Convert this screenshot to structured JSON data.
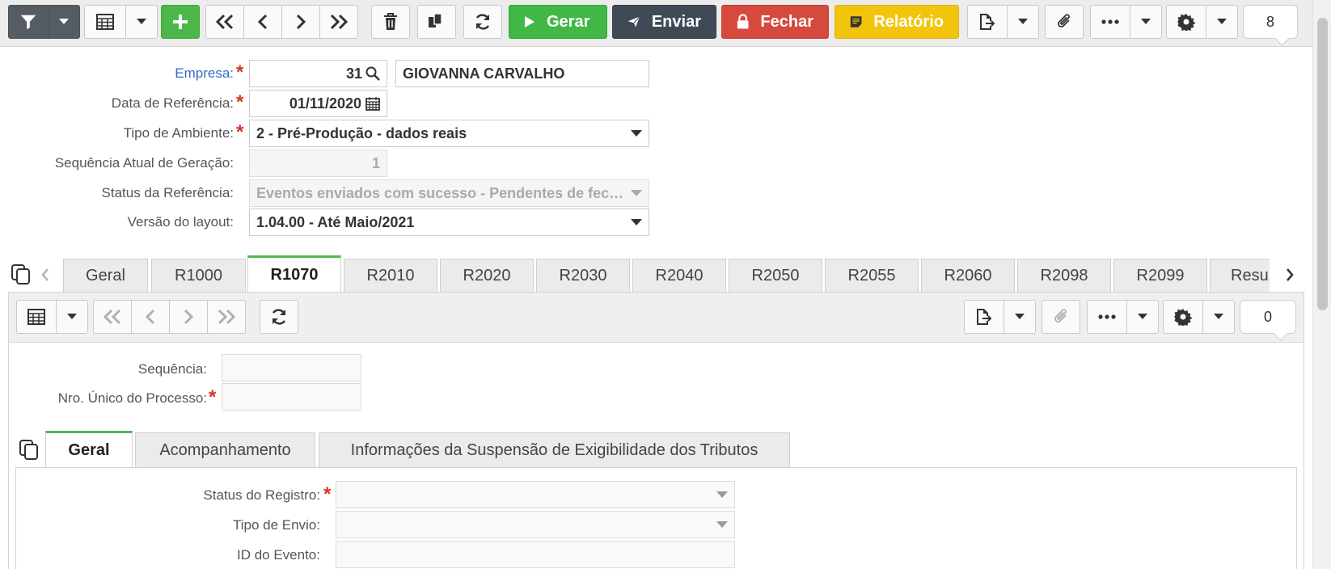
{
  "toolbar": {
    "gerar_label": "Gerar",
    "enviar_label": "Enviar",
    "fechar_label": "Fechar",
    "relatorio_label": "Relatório",
    "record_count": "8",
    "colors": {
      "gerar": "#41b845",
      "enviar": "#3f4a56",
      "fechar": "#d64a3d",
      "relatorio": "#f2c50c",
      "add": "#4cb849"
    }
  },
  "form": {
    "empresa": {
      "label": "Empresa:",
      "code": "31",
      "name": "GIOVANNA CARVALHO"
    },
    "data_referencia": {
      "label": "Data de Referência:",
      "value": "01/11/2020"
    },
    "tipo_ambiente": {
      "label": "Tipo de Ambiente:",
      "value": "2 - Pré-Produção - dados reais"
    },
    "sequencia_atual": {
      "label": "Sequência Atual de Geração:",
      "value": "1"
    },
    "status_referencia": {
      "label": "Status da Referência:",
      "value": "Eventos enviados com sucesso - Pendentes de fechamento"
    },
    "versao_layout": {
      "label": "Versão do layout:",
      "value": "1.04.00 - Até Maio/2021"
    }
  },
  "tabs": [
    "Geral",
    "R1000",
    "R1070",
    "R2010",
    "R2020",
    "R2030",
    "R2040",
    "R2050",
    "R2055",
    "R2060",
    "R2098",
    "R2099",
    "Resumo"
  ],
  "active_tab": "R1070",
  "detail": {
    "record_count": "0",
    "sequencia_label": "Sequência:",
    "nro_processo_label": "Nro. Único do Processo:",
    "subtabs": [
      "Geral",
      "Acompanhamento",
      "Informações da Suspensão de Exigibilidade dos Tributos"
    ],
    "active_subtab": "Geral",
    "status_registro_label": "Status do Registro:",
    "tipo_envio_label": "Tipo de Envio:",
    "id_evento_label": "ID do Evento:"
  }
}
